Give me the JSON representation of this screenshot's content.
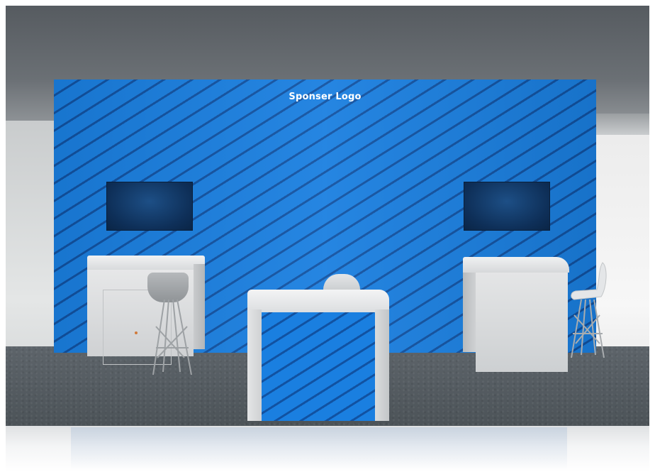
{
  "backwall": {
    "logo_text": "Sponser Logo",
    "color": "#1a7fe0",
    "pattern_color": "#0a2d6e"
  },
  "screens": [
    {
      "name": "left-monitor"
    },
    {
      "name": "right-monitor"
    }
  ],
  "colors": {
    "ceiling": "#5b6065",
    "carpet": "#545b60",
    "counter": "#dcdee0",
    "floor": "#f2f3f4"
  }
}
